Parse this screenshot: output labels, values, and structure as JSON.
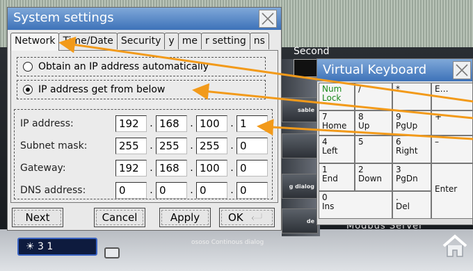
{
  "background": {
    "second_label": "Second",
    "side_buttons": [
      "sable",
      "",
      "g dialog",
      "de"
    ],
    "ghost_text": "Modbus Server",
    "caption": "ososo Continous dialog",
    "widget_text": "☀  3 1",
    "home_icon": "home-icon"
  },
  "dialog": {
    "title": "System settings",
    "tabs": [
      {
        "label": "Network",
        "active": true
      },
      {
        "label": "Time/Date",
        "active": false
      },
      {
        "label": "Security",
        "active": false
      },
      {
        "label": "y",
        "active": false
      },
      {
        "label": "me",
        "active": false
      },
      {
        "label": "r setting",
        "active": false
      },
      {
        "label": "ns",
        "active": false
      }
    ],
    "radio_auto": "Obtain an IP address automatically",
    "radio_manual": "IP address get from below",
    "selected_radio": "manual",
    "fields": [
      {
        "label": "IP address:",
        "octets": [
          "192",
          "168",
          "100",
          "1"
        ]
      },
      {
        "label": "Subnet mask:",
        "octets": [
          "255",
          "255",
          "255",
          "0"
        ]
      },
      {
        "label": "Gateway:",
        "octets": [
          "192",
          "168",
          "100",
          "0"
        ]
      },
      {
        "label": "DNS address:",
        "octets": [
          "0",
          "0",
          "0",
          "0"
        ]
      }
    ],
    "buttons": {
      "next": "Next",
      "cancel": "Cancel",
      "apply": "Apply",
      "ok": "OK"
    }
  },
  "keyboard": {
    "title": "Virtual Keyboard",
    "keys": [
      {
        "main": "Num",
        "sub": "Lock"
      },
      {
        "main": "/",
        "sub": ""
      },
      {
        "main": "*",
        "sub": ""
      },
      {
        "main": "E…",
        "sub": ""
      },
      {
        "main": "7",
        "sub": "Home"
      },
      {
        "main": "8",
        "sub": "Up"
      },
      {
        "main": "9",
        "sub": "PgUp"
      },
      {
        "main": "+",
        "sub": ""
      },
      {
        "main": "4",
        "sub": "Left"
      },
      {
        "main": "5",
        "sub": ""
      },
      {
        "main": "6",
        "sub": "Right"
      },
      {
        "main": "–",
        "sub": ""
      },
      {
        "main": "1",
        "sub": "End"
      },
      {
        "main": "2",
        "sub": "Down"
      },
      {
        "main": "3",
        "sub": "PgDn"
      },
      {
        "main": "Enter",
        "sub": ""
      },
      {
        "main": "0",
        "sub": "Ins"
      },
      {
        "main": ".",
        "sub": "Del"
      }
    ]
  },
  "colors": {
    "title_bar": "#3d72b9",
    "arrow": "#f29a1a"
  }
}
